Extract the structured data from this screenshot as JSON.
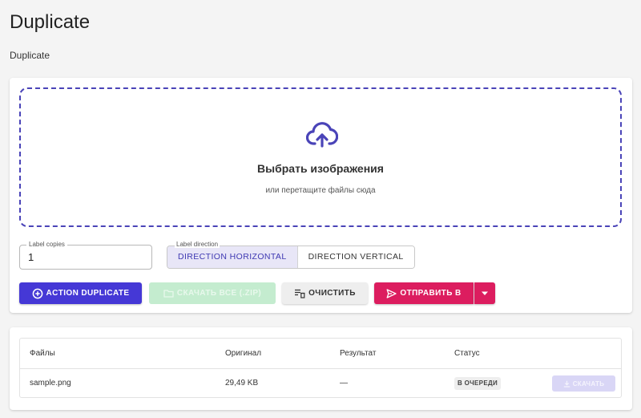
{
  "page": {
    "title": "Duplicate",
    "subtitle": "Duplicate"
  },
  "dropzone": {
    "title": "Выбрать изображения",
    "hint": "или перетащите файлы сюда",
    "icon": "cloud-upload-icon",
    "accent": "#4a44b8"
  },
  "copies": {
    "label": "Label copies",
    "value": "1"
  },
  "direction": {
    "label": "Label direction",
    "options": [
      "DIRECTION HORIZONTAL",
      "DIRECTION VERTICAL"
    ],
    "selected": "DIRECTION HORIZONTAL"
  },
  "toolbar": {
    "duplicate_label": "ACTION DUPLICATE",
    "zip_label": "СКАЧАТЬ ВСЕ (.ZIP)",
    "clear_label": "ОЧИСТИТЬ",
    "send_label": "ОТПРАВИТЬ В",
    "colors": {
      "primary": "#4538d6",
      "success_disabled": "#c4eccf",
      "send": "#dc1d5f"
    }
  },
  "table": {
    "headers": [
      "Файлы",
      "Оригинал",
      "Результат",
      "Статус"
    ],
    "rows": [
      {
        "file": "sample.png",
        "original": "29,49 KB",
        "result": "—",
        "status": "В ОЧЕРЕДИ",
        "action": "СКАЧАТЬ"
      }
    ]
  }
}
